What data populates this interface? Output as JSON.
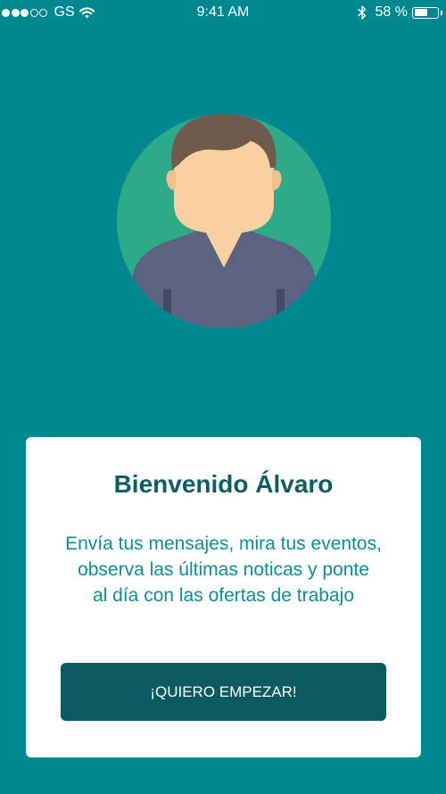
{
  "status_bar": {
    "carrier": "GS",
    "time": "9:41 AM",
    "battery_percent": "58 %",
    "battery_level": 0.58,
    "signal_bars_filled": 3,
    "signal_bars_total": 5,
    "icons": [
      "wifi-icon",
      "bluetooth-icon",
      "battery-icon"
    ]
  },
  "avatar": {
    "icon": "user-avatar",
    "colors": {
      "circle": "#2dab89",
      "hair": "#6e5b4b",
      "skin": "#fad0a1",
      "shirt": "#5b6381"
    }
  },
  "welcome": {
    "title": "Bienvenido Álvaro",
    "lines": [
      "Envía tus mensajes, mira tus eventos,",
      "observa las últimas noticas y ponte",
      "al día con las ofertas de trabajo"
    ],
    "button_label": "¡QUIERO EMPEZAR!"
  },
  "colors": {
    "background": "#008891",
    "title": "#0d5d66",
    "body_text": "#0a8f98",
    "button": "#0b5961"
  }
}
